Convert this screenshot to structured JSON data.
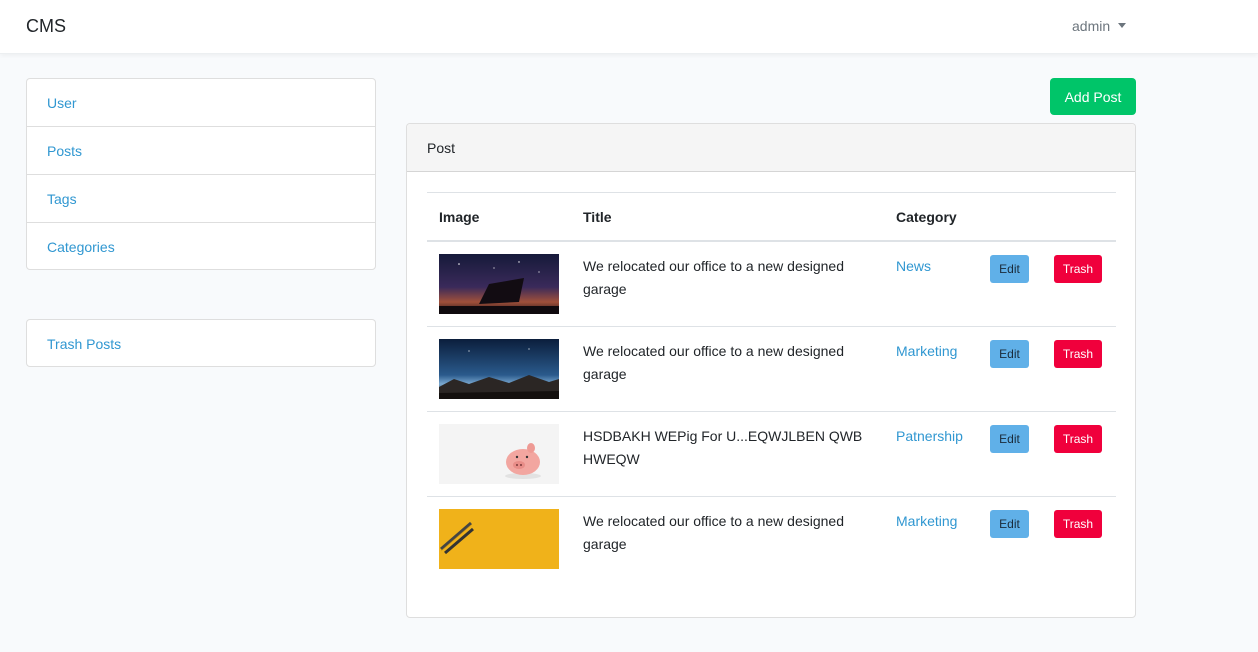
{
  "navbar": {
    "brand": "CMS",
    "user": "admin"
  },
  "sidebar": {
    "items": [
      {
        "label": "User"
      },
      {
        "label": "Posts"
      },
      {
        "label": "Tags"
      },
      {
        "label": "Categories"
      }
    ],
    "secondary": [
      {
        "label": "Trash Posts"
      }
    ]
  },
  "main": {
    "add_button": "Add Post",
    "card_title": "Post",
    "table": {
      "headers": {
        "image": "Image",
        "title": "Title",
        "category": "Category"
      },
      "rows": [
        {
          "image": "boat-night-sky-thumbnail",
          "title": "We relocated our office to a new designed garage",
          "category": "News",
          "edit": "Edit",
          "trash": "Trash"
        },
        {
          "image": "mountain-night-sky-thumbnail",
          "title": "We relocated our office to a new designed garage",
          "category": "Marketing",
          "edit": "Edit",
          "trash": "Trash"
        },
        {
          "image": "piggy-bank-thumbnail",
          "title": "HSDBAKH WEPig For U...EQWJLBEN QWB HWEQW",
          "category": "Patnership",
          "edit": "Edit",
          "trash": "Trash"
        },
        {
          "image": "pencils-yellow-thumbnail",
          "title": "We relocated our office to a new designed garage",
          "category": "Marketing",
          "edit": "Edit",
          "trash": "Trash"
        }
      ]
    }
  },
  "colors": {
    "link": "#3097d1",
    "add_button": "#00c569",
    "edit_button": "#60b0e8",
    "trash_button": "#f0003c"
  }
}
